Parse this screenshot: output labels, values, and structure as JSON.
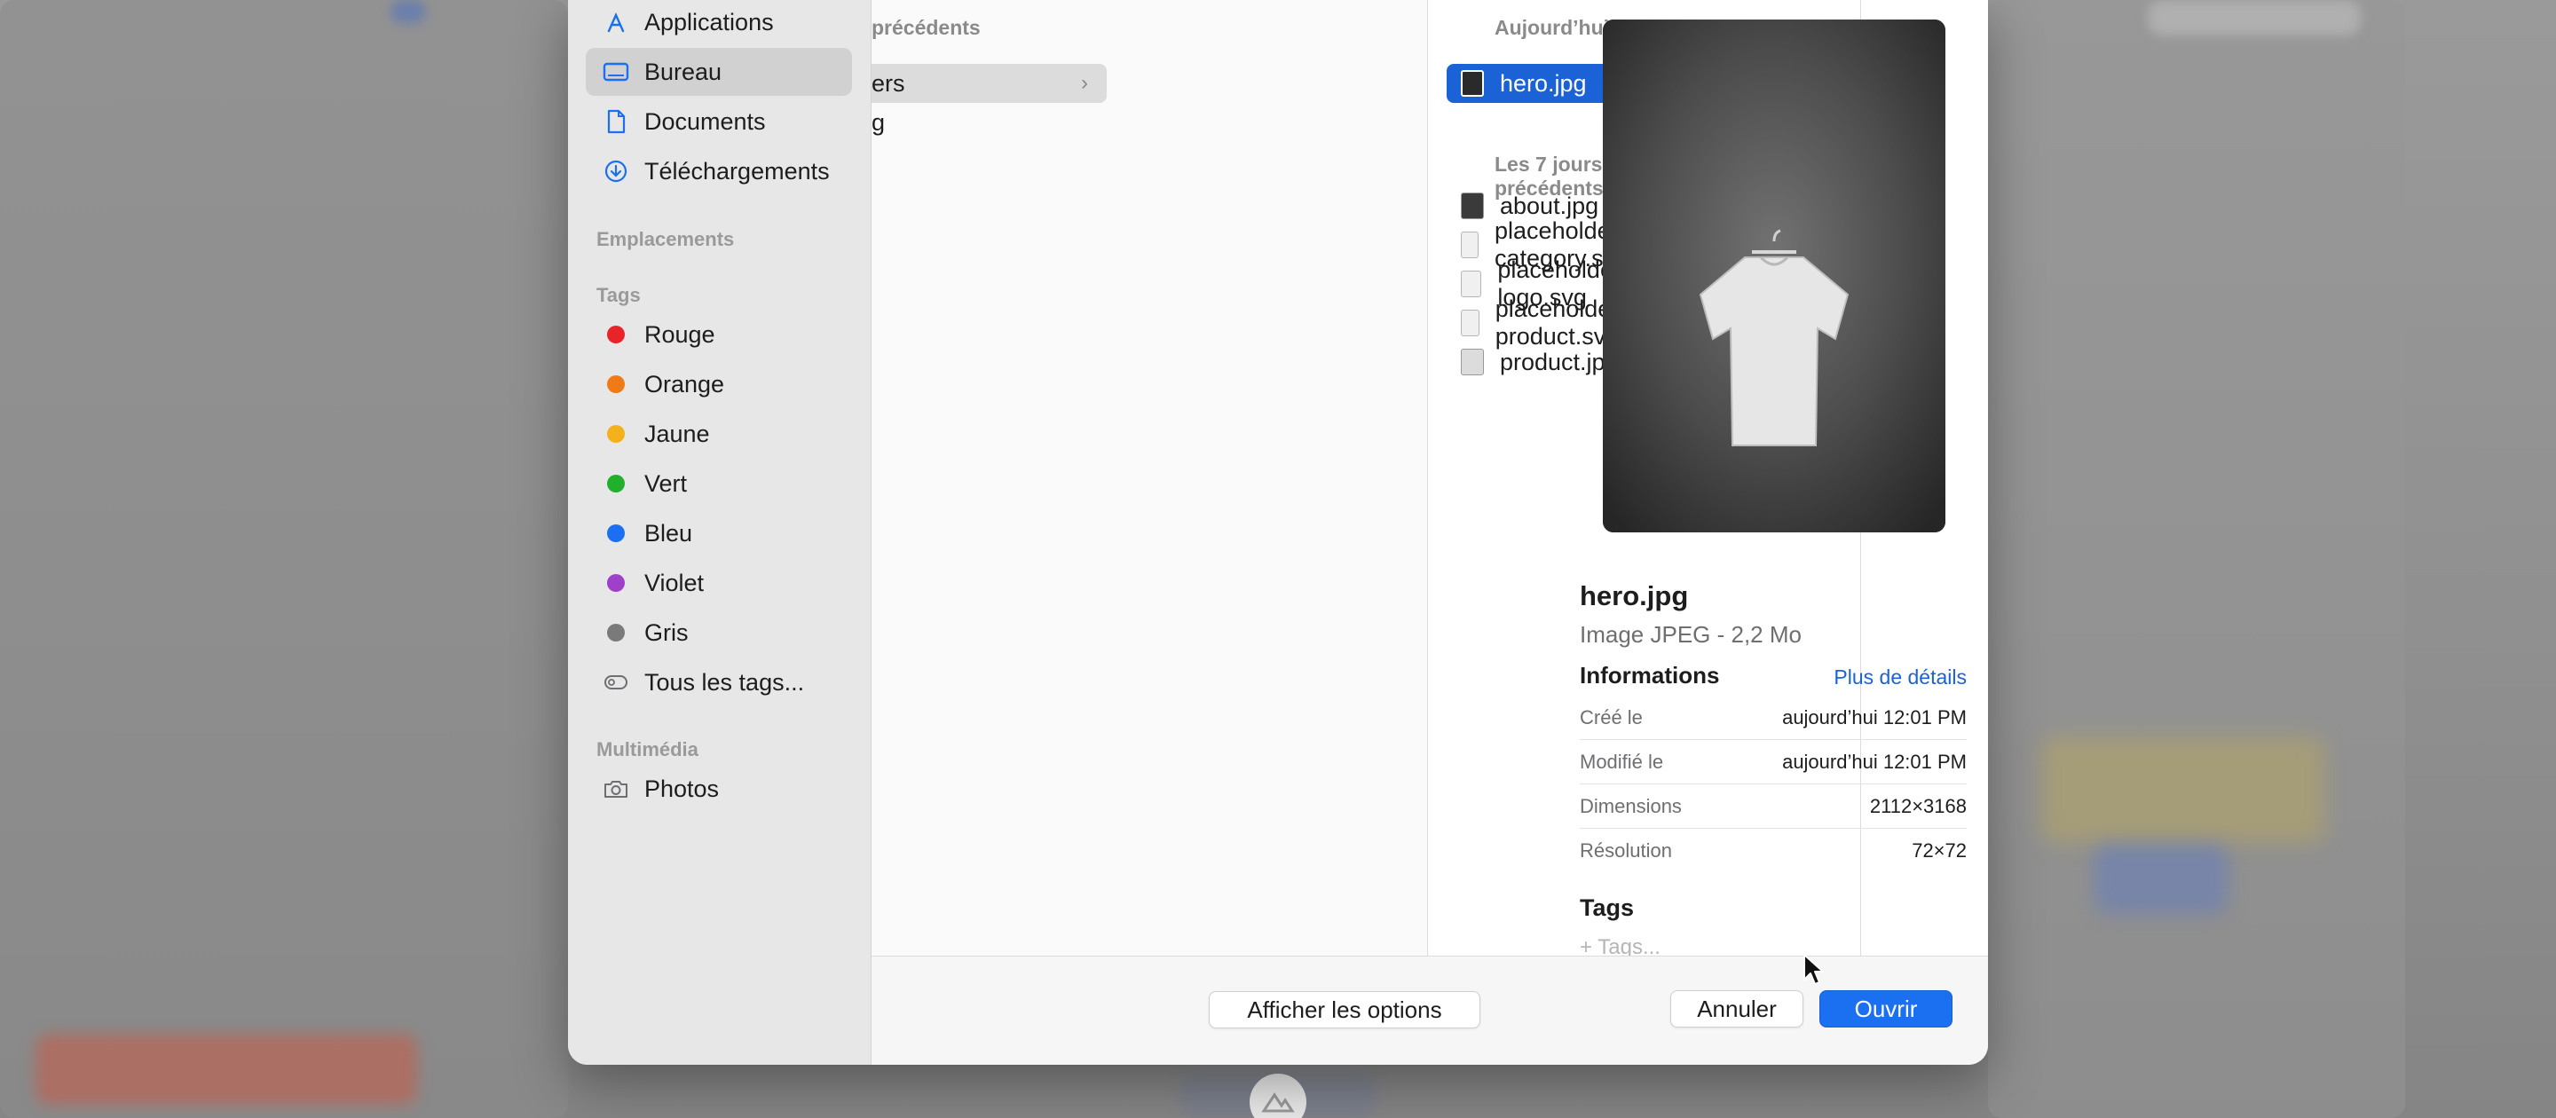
{
  "sidebar": {
    "favorites": [
      {
        "label": "Applications",
        "icon": "applications-icon"
      },
      {
        "label": "Bureau",
        "icon": "desktop-icon",
        "selected": true
      },
      {
        "label": "Documents",
        "icon": "document-icon"
      },
      {
        "label": "Téléchargements",
        "icon": "download-icon"
      }
    ],
    "locations_header": "Emplacements",
    "tags_header": "Tags",
    "tags": [
      {
        "label": "Rouge",
        "color": "#e8232a"
      },
      {
        "label": "Orange",
        "color": "#f07a16"
      },
      {
        "label": "Jaune",
        "color": "#f3b21b"
      },
      {
        "label": "Vert",
        "color": "#22b02c"
      },
      {
        "label": "Bleu",
        "color": "#1b6ff0"
      },
      {
        "label": "Violet",
        "color": "#9e40c9"
      },
      {
        "label": "Gris",
        "color": "#7a7a7a"
      }
    ],
    "all_tags": "Tous les tags...",
    "media_header": "Multimédia",
    "photos": "Photos"
  },
  "columns": {
    "col1_header": "précédents",
    "col1_items": [
      "ers",
      "g"
    ],
    "col2_header_today": "Aujourd’hui",
    "col2_today_items": [
      "hero.jpg"
    ],
    "col2_header_week": "Les 7 jours précédents",
    "col2_week_items": [
      "about.jpg",
      "placeholder-category.svg",
      "placeholder-logo.svg",
      "placeholder-product.svg",
      "product.jpg"
    ]
  },
  "preview": {
    "filename": "hero.jpg",
    "kind": "Image JPEG - 2,2 Mo",
    "info_header": "Informations",
    "more_details": "Plus de détails",
    "rows": [
      {
        "key": "Créé le",
        "value": "aujourd’hui 12:01 PM"
      },
      {
        "key": "Modifié le",
        "value": "aujourd’hui 12:01 PM"
      },
      {
        "key": "Dimensions",
        "value": "2112×3168"
      },
      {
        "key": "Résolution",
        "value": "72×72"
      }
    ],
    "tags_header": "Tags",
    "tags_placeholder": "+ Tags..."
  },
  "footer": {
    "options_button": "Afficher les options",
    "cancel_button": "Annuler",
    "open_button": "Ouvrir"
  }
}
